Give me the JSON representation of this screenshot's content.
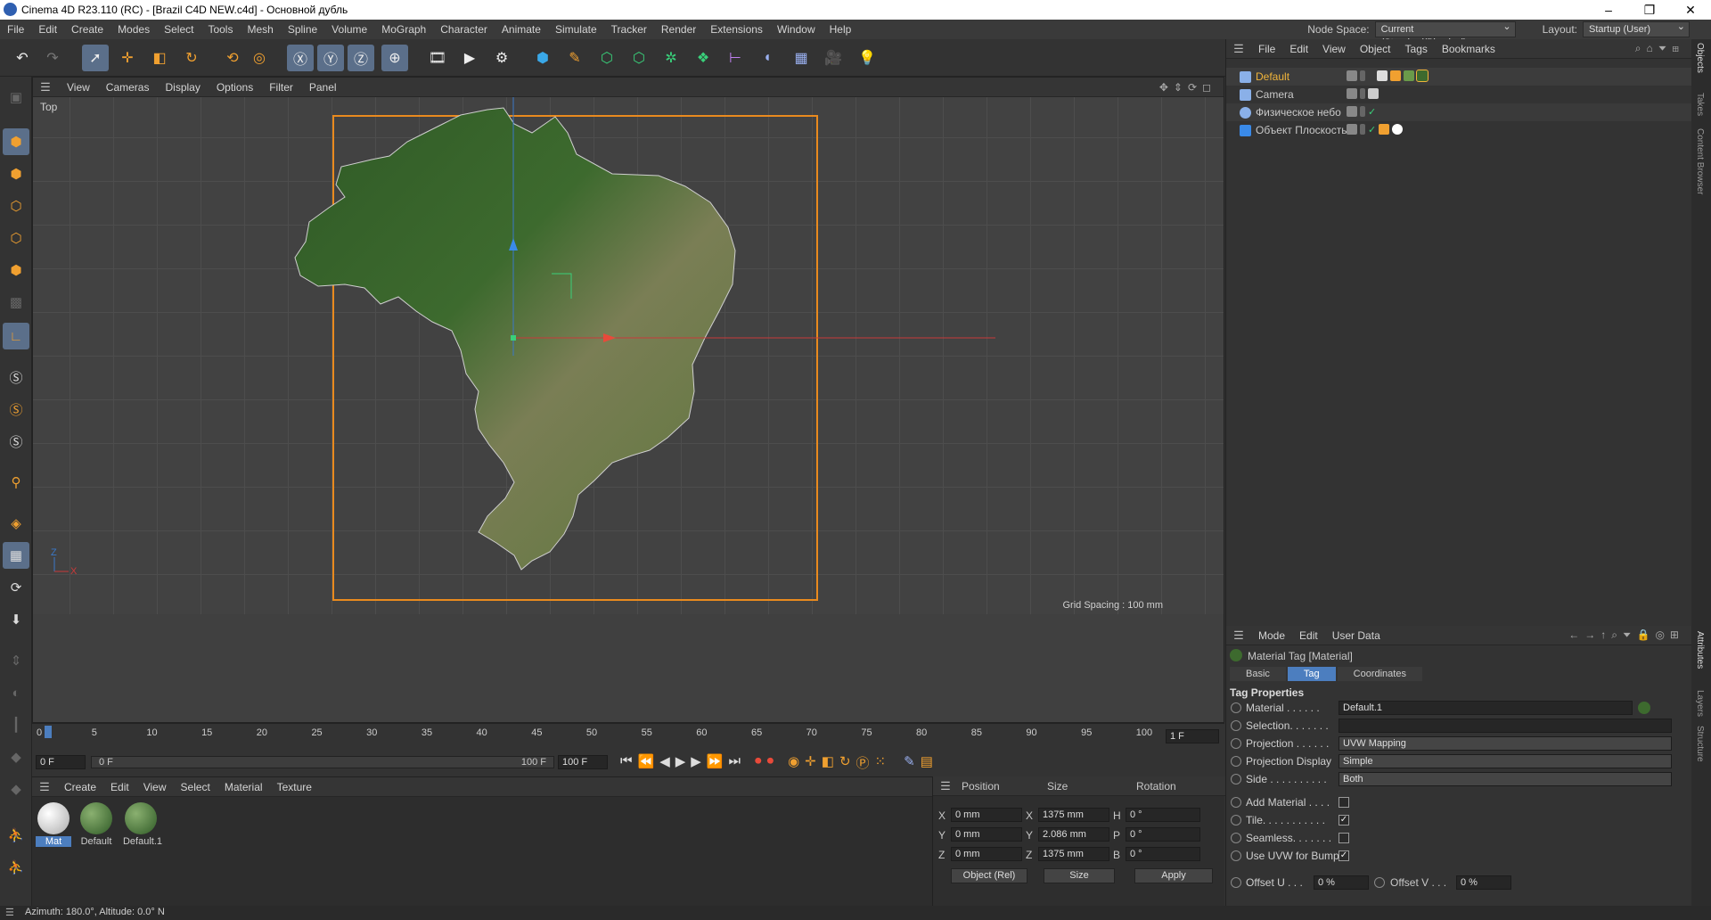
{
  "window": {
    "title": "Cinema 4D R23.110 (RC) - [Brazil C4D NEW.c4d] - Основной дубль",
    "minimize": "–",
    "maximize": "❐",
    "close": "✕"
  },
  "menu": [
    "File",
    "Edit",
    "Create",
    "Modes",
    "Select",
    "Tools",
    "Mesh",
    "Spline",
    "Volume",
    "MoGraph",
    "Character",
    "Animate",
    "Simulate",
    "Tracker",
    "Render",
    "Extensions",
    "Window",
    "Help"
  ],
  "nodespace": {
    "label": "Node Space:",
    "value": "Current (Standard/Physical)",
    "layout_label": "Layout:",
    "layout_value": "Startup (User)"
  },
  "viewport": {
    "menu": [
      "View",
      "Cameras",
      "Display",
      "Options",
      "Filter",
      "Panel"
    ],
    "name": "Top",
    "grid_spacing": "Grid Spacing : 100 mm"
  },
  "timeline": {
    "ticks": [
      "0",
      "5",
      "10",
      "15",
      "20",
      "25",
      "30",
      "35",
      "40",
      "45",
      "50",
      "55",
      "60",
      "65",
      "70",
      "75",
      "80",
      "85",
      "90",
      "95",
      "100"
    ],
    "current_frame": "1 F"
  },
  "playback": {
    "start": "0 F",
    "cursor": "0 F",
    "end_range": "100 F",
    "end": "100 F"
  },
  "materials": {
    "menu": [
      "Create",
      "Edit",
      "View",
      "Select",
      "Material",
      "Texture"
    ],
    "items": [
      "Mat",
      "Default",
      "Default.1"
    ]
  },
  "coords": {
    "headers": [
      "Position",
      "Size",
      "Rotation"
    ],
    "rows": [
      {
        "axis": "X",
        "pos": "0 mm",
        "saxis": "X",
        "size": "1375 mm",
        "raxis": "H",
        "rot": "0 °"
      },
      {
        "axis": "Y",
        "pos": "0 mm",
        "saxis": "Y",
        "size": "2.086 mm",
        "raxis": "P",
        "rot": "0 °"
      },
      {
        "axis": "Z",
        "pos": "0 mm",
        "saxis": "Z",
        "size": "1375 mm",
        "raxis": "B",
        "rot": "0 °"
      }
    ],
    "mode": "Object (Rel)",
    "size_mode": "Size",
    "apply": "Apply"
  },
  "objects": {
    "menu": [
      "File",
      "Edit",
      "View",
      "Object",
      "Tags",
      "Bookmarks"
    ],
    "items": [
      {
        "name": "Default",
        "color": "#f0b43a"
      },
      {
        "name": "Camera",
        "color": "#cfcfcf"
      },
      {
        "name": "Физическое небо",
        "color": "#cfcfcf"
      },
      {
        "name": "Объект Плоскость",
        "color": "#cfcfcf"
      }
    ]
  },
  "attributes": {
    "menu": [
      "Mode",
      "Edit",
      "User Data"
    ],
    "title": "Material Tag [Material]",
    "tabs": [
      "Basic",
      "Tag",
      "Coordinates"
    ],
    "section": "Tag Properties",
    "fields": [
      {
        "label": "Material . . . . . .",
        "value": "Default.1"
      },
      {
        "label": "Selection. . . . . . .",
        "value": ""
      },
      {
        "label": "Projection . . . . . .",
        "value": "UVW Mapping"
      },
      {
        "label": "Projection Display",
        "value": "Simple"
      },
      {
        "label": "Side . . . . . . . . . .",
        "value": "Both"
      }
    ],
    "checks": [
      {
        "label": "Add Material . . . .",
        "checked": ""
      },
      {
        "label": "Tile. . . . . . . . . . .",
        "checked": "✓"
      },
      {
        "label": "Seamless. . . . . . .",
        "checked": ""
      },
      {
        "label": "Use UVW for Bump",
        "checked": "✓"
      }
    ],
    "offset_u_label": "Offset U . . .",
    "offset_u": "0 %",
    "offset_v_label": "Offset V . . .",
    "offset_v": "0 %"
  },
  "rightstrip": [
    "Objects",
    "Takes",
    "Content Browser",
    "Attributes",
    "Layers",
    "Structure"
  ],
  "status": "Azimuth: 180.0°, Altitude: 0.0°  N",
  "axis_labels": {
    "x": "X",
    "z": "Z"
  }
}
